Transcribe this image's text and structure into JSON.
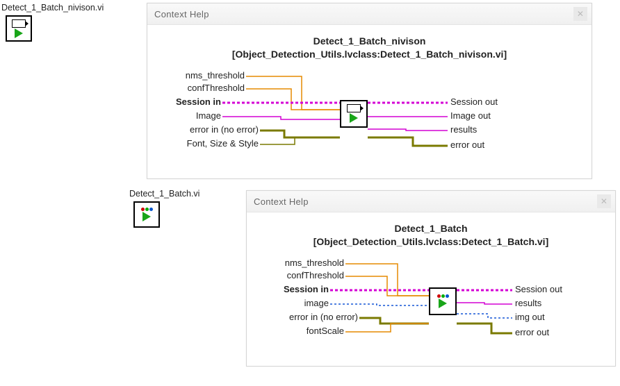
{
  "icon1_label": "Detect_1_Batch_nivison.vi",
  "icon2_label": "Detect_1_Batch.vi",
  "help_window_title": "Context Help",
  "vi1": {
    "title_line1": "Detect_1_Batch_nivison",
    "title_line2": "[Object_Detection_Utils.lvclass:Detect_1_Batch_nivison.vi]",
    "left_terminals": [
      "nms_threshold",
      "confThreshold",
      "Session in",
      "Image",
      "error in (no error)",
      "Font, Size & Style"
    ],
    "right_terminals": [
      "Session out",
      "Image out",
      "results",
      "error out"
    ]
  },
  "vi2": {
    "title_line1": "Detect_1_Batch",
    "title_line2": "[Object_Detection_Utils.lvclass:Detect_1_Batch.vi]",
    "left_terminals": [
      "nms_threshold",
      "confThreshold",
      "Session in",
      "image",
      "error in (no error)",
      "fontScale"
    ],
    "right_terminals": [
      "Session out",
      "results",
      "img out",
      "error out"
    ]
  }
}
